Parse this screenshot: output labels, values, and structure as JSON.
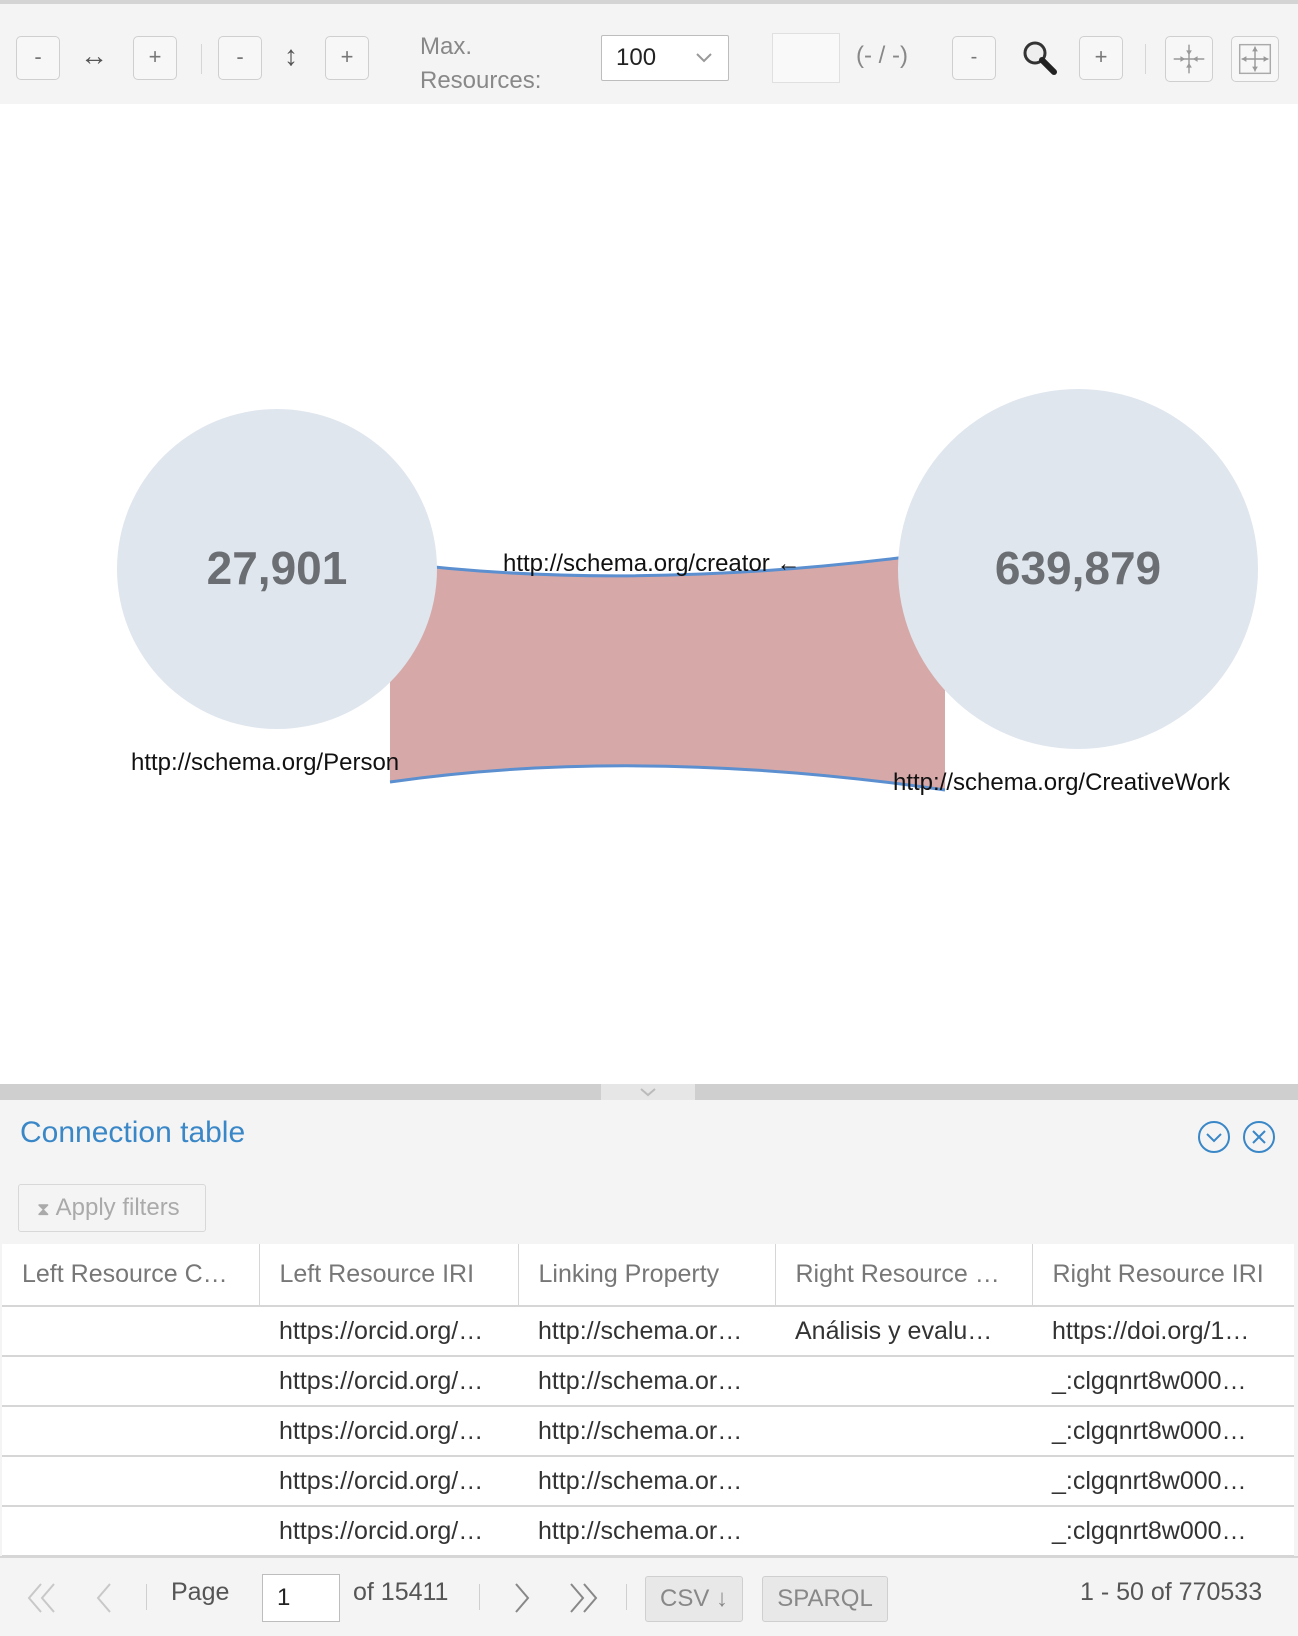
{
  "toolbar": {
    "h_minus": "-",
    "h_icon": "↔",
    "h_plus": "+",
    "v_minus": "-",
    "v_icon": "↕",
    "v_plus": "+",
    "max_resources_label": "Max. Resources:",
    "max_resources_value": "100",
    "search_counter": "(- / -)",
    "zoom_minus": "-",
    "zoom_plus": "+"
  },
  "graph": {
    "left_node": {
      "count": "27,901",
      "label": "http://schema.org/Person"
    },
    "right_node": {
      "count": "639,879",
      "label": "http://schema.org/CreativeWork"
    },
    "edge": {
      "label": "http://schema.org/creator ←"
    },
    "colors": {
      "node_fill": "#dfe6ee",
      "edge_fill": "#d6a9a8",
      "edge_stroke": "#5b8fcf"
    }
  },
  "panel": {
    "title": "Connection table",
    "apply_filters": "Apply filters",
    "columns": [
      "Left Resource C…",
      "Left Resource IRI",
      "Linking Property",
      "Right Resource …",
      "Right Resource IRI"
    ],
    "rows": [
      [
        "",
        "https://orcid.org/…",
        "http://schema.or…",
        "Análisis y evalu…",
        "https://doi.org/1…"
      ],
      [
        "",
        "https://orcid.org/…",
        "http://schema.or…",
        "",
        "_:clgqnrt8w000…"
      ],
      [
        "",
        "https://orcid.org/…",
        "http://schema.or…",
        "",
        "_:clgqnrt8w000…"
      ],
      [
        "",
        "https://orcid.org/…",
        "http://schema.or…",
        "",
        "_:clgqnrt8w000…"
      ],
      [
        "",
        "https://orcid.org/…",
        "http://schema.or…",
        "",
        "_:clgqnrt8w000…"
      ]
    ]
  },
  "footer": {
    "page_label": "Page",
    "page_value": "1",
    "of_pages": "of 15411",
    "csv_label": "CSV ↓",
    "sparql_label": "SPARQL",
    "range_text": "1 - 50 of 770533"
  }
}
